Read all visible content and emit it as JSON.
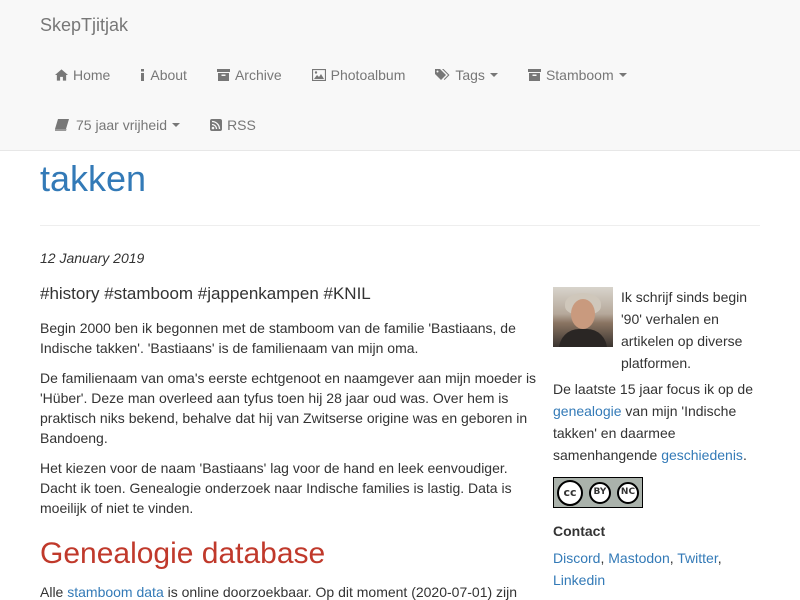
{
  "brand": "SkepTjitjak",
  "nav": {
    "home": "Home",
    "about": "About",
    "archive": "Archive",
    "photoalbum": "Photoalbum",
    "tags": "Tags",
    "stamboom": "Stamboom",
    "vrijheid": "75 jaar vrijheid",
    "rss": "RSS"
  },
  "page": {
    "title": "takken",
    "date": "12 January 2019",
    "tags": "#history #stamboom #jappenkampen #KNIL",
    "p1": "Begin 2000 ben ik begonnen met de stamboom van de familie 'Bastiaans, de Indische takken'. 'Bastiaans' is de familienaam van mijn oma.",
    "p2": "De familienaam van oma's eerste echtgenoot en naamgever aan mijn moeder is 'Hüber'. Deze man overleed aan tyfus toen hij 28 jaar oud was. Over hem is praktisch niks bekend, behalve dat hij van Zwitserse origine was en geboren in Bandoeng.",
    "p3": "Het kiezen voor de naam 'Bastiaans' lag voor de hand en leek eenvoudiger. Dacht ik toen. Genealogie onderzoek naar Indische families is lastig. Data is moeilijk of niet te vinden.",
    "h2": "Genealogie database",
    "p4_pre": "Alle ",
    "p4_link": "stamboom data",
    "p4_post": " is online doorzoekbaar. Op dit moment (2020-07-01) zijn"
  },
  "sidebar": {
    "bio": "Ik schrijf sinds begin '90' verhalen en artikelen op diverse platformen.",
    "focus_pre": "De laatste 15 jaar focus ik op de ",
    "focus_link1": "genealogie",
    "focus_mid": " van mijn 'Indische takken' en daarmee samenhangende ",
    "focus_link2": "geschiedenis",
    "focus_post": ".",
    "license_cc": "cc",
    "license_by": "BY",
    "license_nc": "NC",
    "contact_heading": "Contact",
    "contact_discord": "Discord",
    "contact_mastodon": "Mastodon",
    "contact_twitter": "Twitter",
    "contact_linkedin": "Linkedin",
    "sep": ", "
  },
  "icons": {
    "home": "home-icon",
    "about": "info-icon",
    "archive": "archive-icon",
    "photo": "picture-icon",
    "tags": "tags-icon",
    "stamboom": "archive-icon",
    "book": "book-icon",
    "rss": "rss-icon"
  },
  "colors": {
    "link": "#337ab7",
    "heading2": "#c0392b",
    "navbar_bg": "#f8f8f8",
    "nav_text": "#777777"
  }
}
